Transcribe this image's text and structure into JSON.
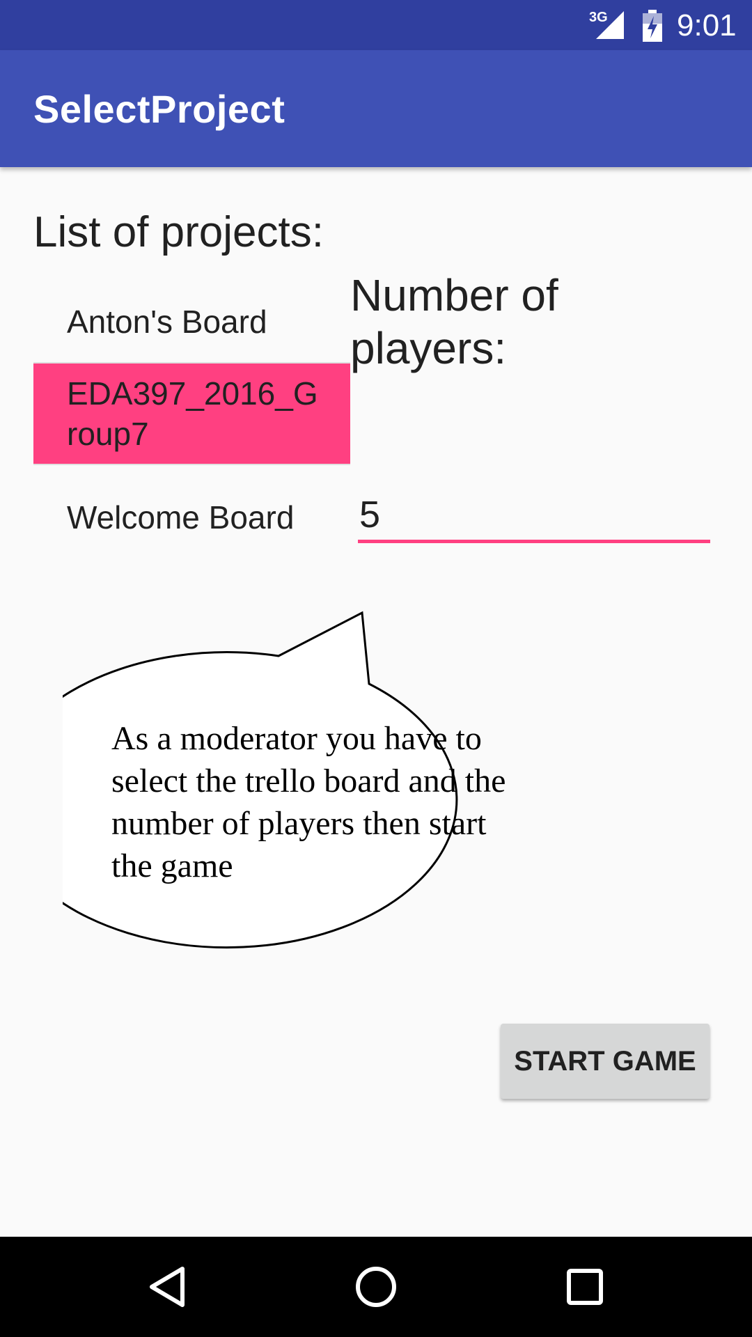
{
  "status_bar": {
    "network": "3G",
    "time": "9:01",
    "color": "#303f9f"
  },
  "app_bar": {
    "title": "SelectProject",
    "color": "#3f51b5"
  },
  "projects": {
    "heading": "List of projects:",
    "items": [
      {
        "label": "Anton's Board",
        "selected": false
      },
      {
        "label": "EDA397_2016_G\nroup7",
        "selected": true
      },
      {
        "label": "Welcome Board",
        "selected": false
      }
    ],
    "selected_color": "#ff4081"
  },
  "players": {
    "heading": "Number of players:",
    "value": "5"
  },
  "speech_bubble": {
    "text": "As a moderator you have to select the trello board and the number of players then start the game"
  },
  "start_button": {
    "label": "START GAME"
  },
  "nav_bar": {
    "icons": [
      "back-icon",
      "home-icon",
      "recents-icon"
    ]
  }
}
